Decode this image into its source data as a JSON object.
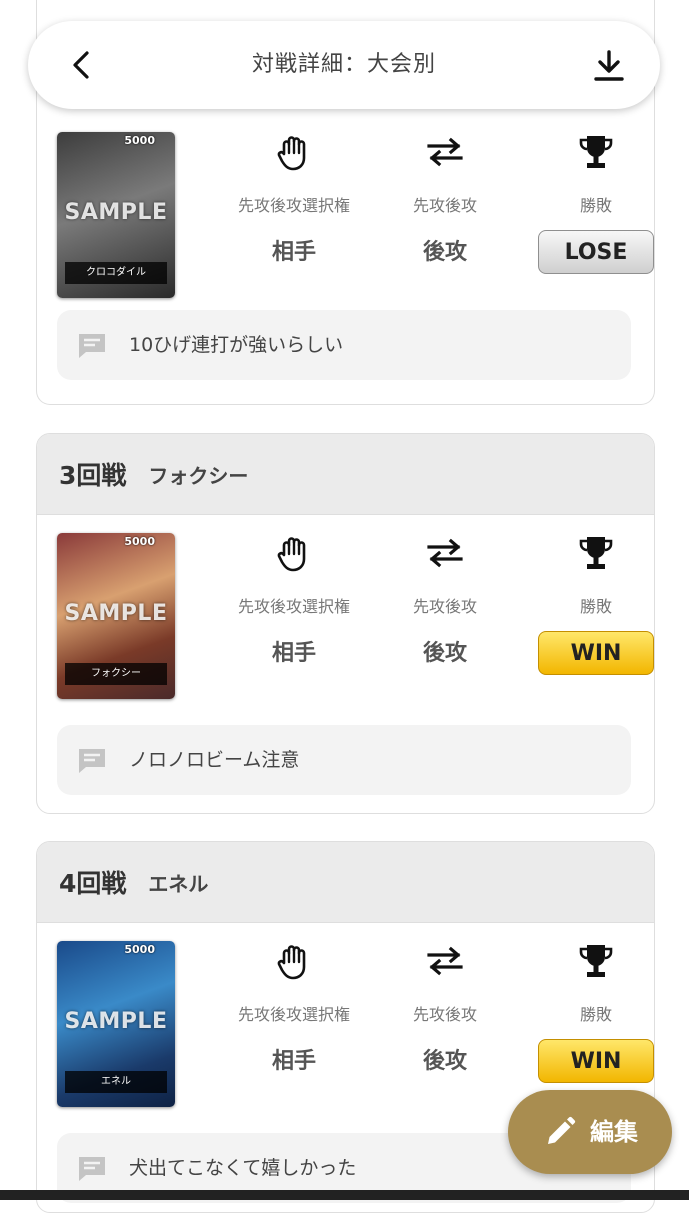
{
  "header": {
    "title": "対戦詳細：大会別",
    "back_icon": "chevron-left-icon",
    "download_icon": "download-icon"
  },
  "labels": {
    "choice": "先攻後攻選択権",
    "order": "先攻後攻",
    "result": "勝敗"
  },
  "card_watermark": "SAMPLE",
  "matches": [
    {
      "round": "",
      "opponent": "",
      "card": {
        "cost": "5000",
        "name": "クロコダイル"
      },
      "choice": "相手",
      "order": "後攻",
      "result": "LOSE",
      "memo": "10ひげ連打が強いらしい"
    },
    {
      "round": "3回戦",
      "opponent": "フォクシー",
      "card": {
        "cost": "5000",
        "name": "フォクシー"
      },
      "choice": "相手",
      "order": "後攻",
      "result": "WIN",
      "memo": "ノロノロビーム注意"
    },
    {
      "round": "4回戦",
      "opponent": "エネル",
      "card": {
        "cost": "5000",
        "name": "エネル"
      },
      "choice": "相手",
      "order": "後攻",
      "result": "WIN",
      "memo": "犬出てこなくて嬉しかった"
    }
  ],
  "fab": {
    "label": "編集",
    "icon": "pencil-icon"
  },
  "colors": {
    "accent": "#a98d50",
    "win": "#f2b600",
    "lose": "#cfcfcf",
    "card_header": "#ebebeb",
    "memo_bg": "#f3f3f3"
  }
}
